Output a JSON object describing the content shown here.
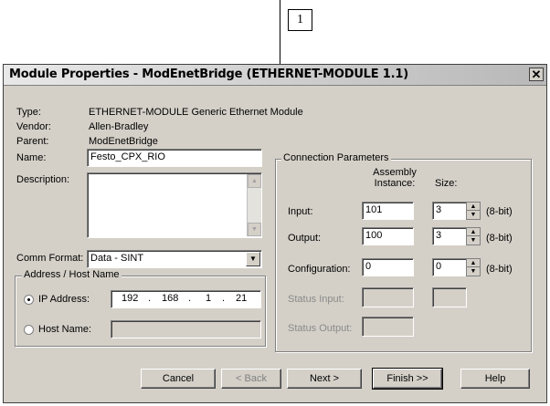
{
  "callout": {
    "number": "1"
  },
  "window": {
    "title": "Module Properties - ModEnetBridge (ETHERNET-MODULE 1.1)",
    "close_glyph": "✕"
  },
  "info": {
    "type_label": "Type:",
    "type_value": "ETHERNET-MODULE Generic Ethernet Module",
    "vendor_label": "Vendor:",
    "vendor_value": "Allen-Bradley",
    "parent_label": "Parent:",
    "parent_value": "ModEnetBridge",
    "name_label": "Name:",
    "name_value": "Festo_CPX_RIO",
    "description_label": "Description:",
    "description_value": "",
    "comm_format_label": "Comm Format:",
    "comm_format_value": "Data - SINT"
  },
  "address_group": {
    "title": "Address / Host Name",
    "ip_label": "IP Address:",
    "ip_octets": [
      "192",
      "168",
      "1",
      "21"
    ],
    "ip_selected": true,
    "host_label": "Host Name:",
    "host_value": ""
  },
  "connection": {
    "title": "Connection Parameters",
    "col_assembly": "Assembly\nInstance:",
    "col_size": "Size:",
    "rows": [
      {
        "label": "Input:",
        "instance": "101",
        "size": "3",
        "unit": "(8-bit)",
        "enabled": true
      },
      {
        "label": "Output:",
        "instance": "100",
        "size": "3",
        "unit": "(8-bit)",
        "enabled": true
      },
      {
        "label": "Configuration:",
        "instance": "0",
        "size": "0",
        "unit": "(8-bit)",
        "enabled": true
      },
      {
        "label": "Status Input:",
        "instance": "",
        "size": "",
        "unit": "",
        "enabled": false
      },
      {
        "label": "Status Output:",
        "instance": "",
        "size": "",
        "unit": "",
        "enabled": false
      }
    ]
  },
  "buttons": {
    "cancel": "Cancel",
    "back": "< Back",
    "next": "Next >",
    "finish": "Finish >>",
    "help": "Help"
  },
  "icons": {
    "spin_up": "▲",
    "spin_down": "▼",
    "dropdown": "▼"
  }
}
